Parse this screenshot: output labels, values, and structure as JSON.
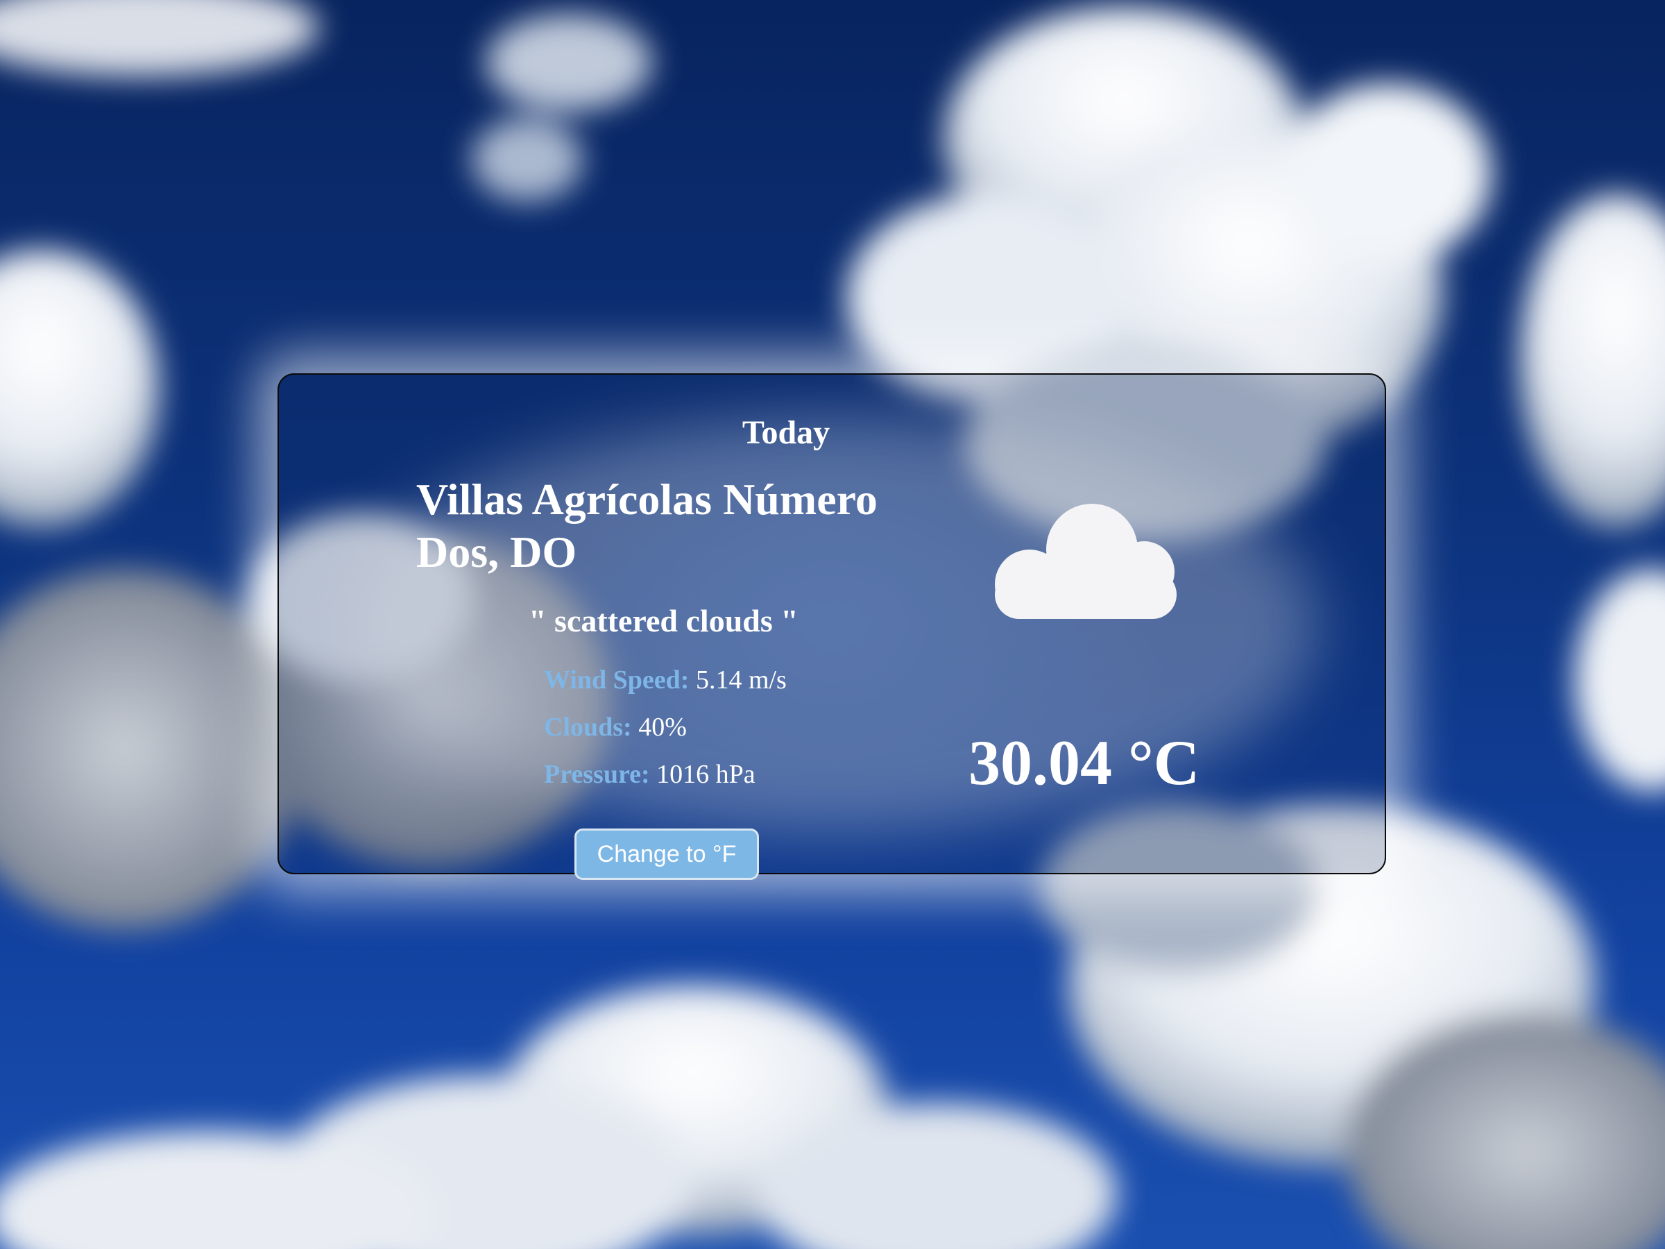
{
  "weather": {
    "day_label": "Today",
    "location": "Villas Agrícolas Número Dos, DO",
    "description": "\" scattered clouds \"",
    "wind_label": "Wind Speed:",
    "wind_value": "5.14 m/s",
    "clouds_label": "Clouds:",
    "clouds_value": "40%",
    "pressure_label": "Pressure:",
    "pressure_value": "1016 hPa",
    "temperature": "30.04 °C",
    "condition_icon": "cloud-icon"
  },
  "controls": {
    "unit_toggle_label": "Change to °F"
  },
  "colors": {
    "label_accent": "#7eb6e8",
    "button_bg": "#7db7e6",
    "text": "#ffffff"
  }
}
